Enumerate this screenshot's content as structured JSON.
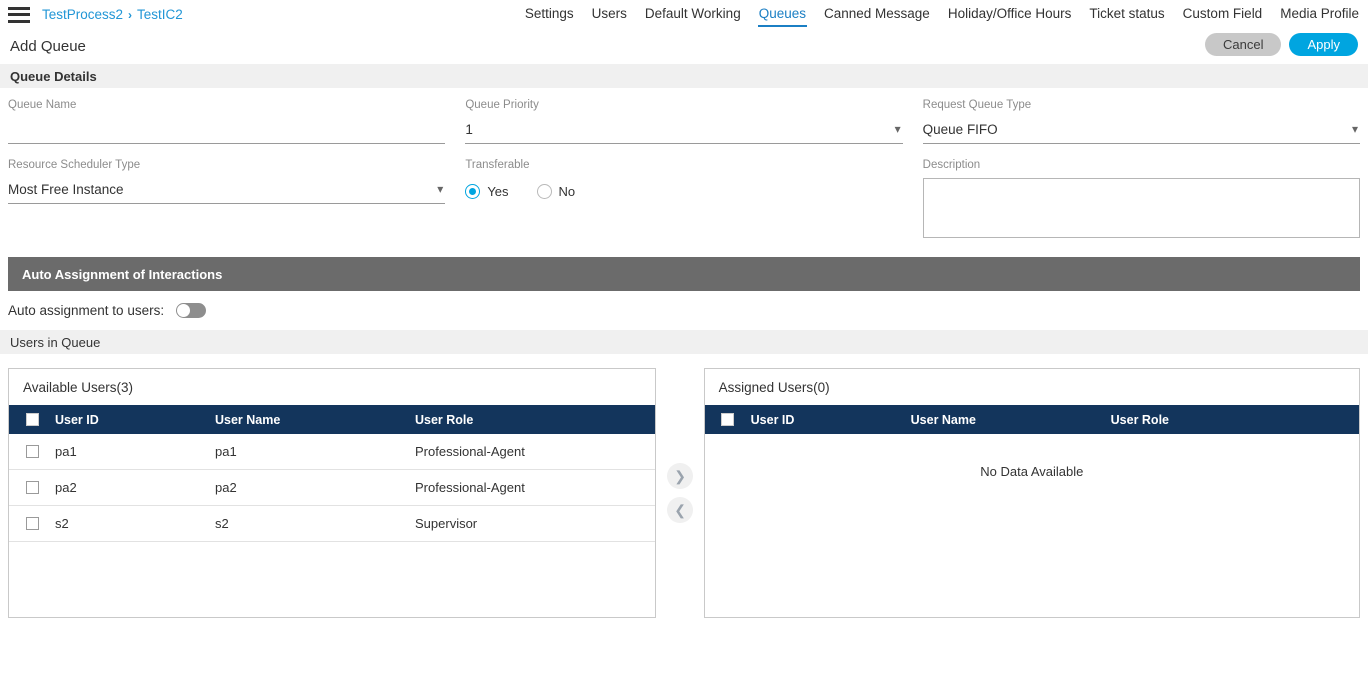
{
  "topbar": {
    "menu_icon": "hamburger-icon",
    "breadcrumb": {
      "root": "TestProcess2",
      "separator": "›",
      "current": "TestIC2"
    },
    "nav_tabs": [
      {
        "label": "Settings",
        "active": false
      },
      {
        "label": "Users",
        "active": false
      },
      {
        "label": "Default Working",
        "active": false
      },
      {
        "label": "Queues",
        "active": true
      },
      {
        "label": "Canned Message",
        "active": false
      },
      {
        "label": "Holiday/Office Hours",
        "active": false
      },
      {
        "label": "Ticket status",
        "active": false
      },
      {
        "label": "Custom Field",
        "active": false
      },
      {
        "label": "Media Profile",
        "active": false
      }
    ]
  },
  "header": {
    "title": "Add Queue",
    "cancel_label": "Cancel",
    "apply_label": "Apply"
  },
  "queue_details": {
    "section_title": "Queue Details",
    "queue_name": {
      "label": "Queue Name",
      "value": "",
      "placeholder": ""
    },
    "resource_scheduler_type": {
      "label": "Resource Scheduler Type",
      "value": "Most Free Instance",
      "options": [
        "Most Free Instance"
      ]
    },
    "queue_priority": {
      "label": "Queue Priority",
      "value": "1",
      "options": [
        "1"
      ]
    },
    "transferable": {
      "label": "Transferable",
      "selected": "Yes",
      "options": [
        {
          "label": "Yes",
          "selected": true
        },
        {
          "label": "No",
          "selected": false
        }
      ]
    },
    "request_queue_type": {
      "label": "Request Queue Type",
      "value": "Queue FIFO",
      "options": [
        "Queue FIFO"
      ]
    },
    "description": {
      "label": "Description",
      "value": "",
      "placeholder": ""
    }
  },
  "auto_assignment": {
    "section_title": "Auto Assignment of Interactions",
    "toggle_label": "Auto assignment to users:",
    "toggle_state": "off"
  },
  "users_in_queue": {
    "section_title": "Users in Queue",
    "available": {
      "title": "Available Users(3)",
      "columns": [
        "User ID",
        "User Name",
        "User Role"
      ],
      "rows": [
        {
          "user_id": "pa1",
          "user_name": "pa1",
          "user_role": "Professional-Agent",
          "checked": false
        },
        {
          "user_id": "pa2",
          "user_name": "pa2",
          "user_role": "Professional-Agent",
          "checked": false
        },
        {
          "user_id": "s2",
          "user_name": "s2",
          "user_role": "Supervisor",
          "checked": false
        }
      ]
    },
    "assigned": {
      "title": "Assigned Users(0)",
      "columns": [
        "User ID",
        "User Name",
        "User Role"
      ],
      "rows": [],
      "empty_text": "No Data Available"
    },
    "move_right_icon": "chevron-right-icon",
    "move_left_icon": "chevron-left-icon"
  },
  "colors": {
    "accent_blue": "#00a5e0",
    "link_blue": "#2196d6",
    "table_header_navy": "#13355c",
    "section_dark": "#6b6b6b",
    "section_light": "#f0f0f0"
  }
}
